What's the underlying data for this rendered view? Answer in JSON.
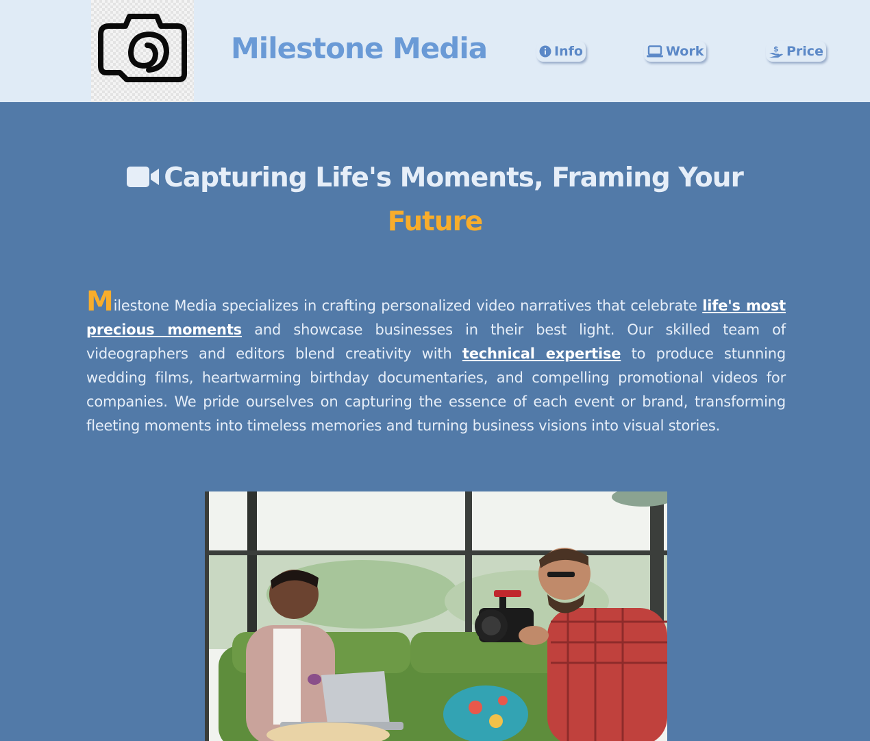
{
  "header": {
    "logo": {
      "icon": "camera-logo-icon"
    },
    "brand": "Milestone Media",
    "nav": [
      {
        "label": "Info",
        "icon": "info-circle-icon"
      },
      {
        "label": "Work",
        "icon": "laptop-icon"
      },
      {
        "label": "Price",
        "icon": "hand-dollar-icon"
      }
    ]
  },
  "hero": {
    "icon": "video-camera-icon",
    "title_main": "Capturing Life's Moments, Framing Your",
    "title_accent": "Future"
  },
  "intro": {
    "dropcap": "M",
    "part1": "ilestone Media specializes in crafting personalized video narratives that celebrate ",
    "link1": "life's most precious moments",
    "part2": " and showcase businesses in their best light. Our skilled team of videographers and editors blend creativity with ",
    "link2": "technical expertise",
    "part3": " to produce stunning wedding films, heartwarming birthday documentaries, and compelling promotional videos for companies. We pride ourselves on capturing the essence of each event or brand, transforming fleeting moments into timeless memories and turning business visions into visual stories."
  },
  "photo": {
    "description_icon": "videographer-photo"
  },
  "colors": {
    "header_bg": "#e0ebf6",
    "page_bg": "#527aa8",
    "brand": "#6a9ad6",
    "accent": "#f8ad2c",
    "text": "#e6eef8"
  }
}
